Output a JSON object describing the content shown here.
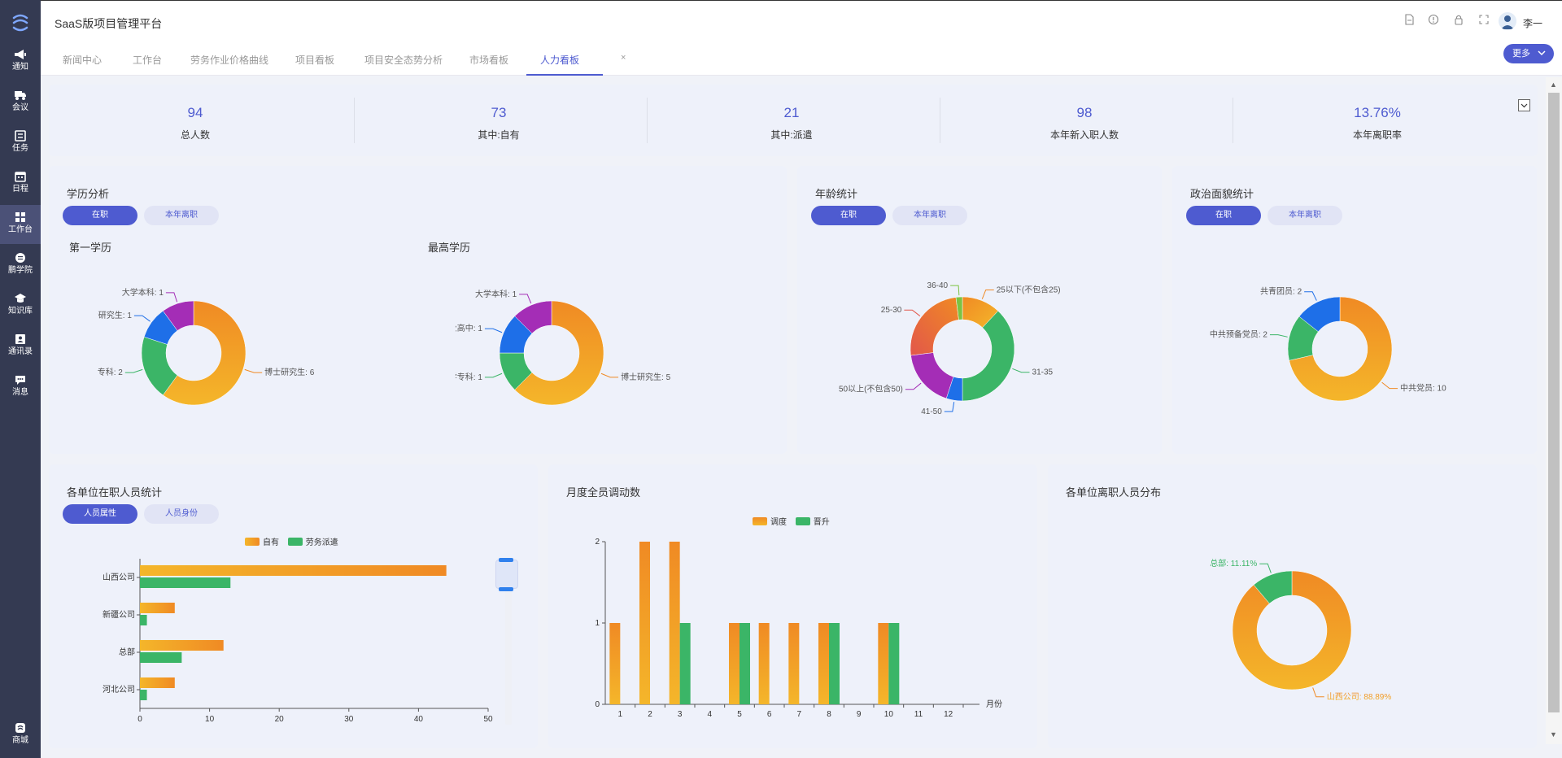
{
  "app": {
    "title": "SaaS版项目管理平台",
    "user_name": "李一",
    "more_label": "更多"
  },
  "nav": [
    {
      "label": "通知",
      "icon": "megaphone-icon"
    },
    {
      "label": "会议",
      "icon": "truck-icon"
    },
    {
      "label": "任务",
      "icon": "task-list-icon"
    },
    {
      "label": "日程",
      "icon": "calendar-icon"
    },
    {
      "label": "工作台",
      "icon": "grid-icon"
    },
    {
      "label": "鹏学院",
      "icon": "academy-icon"
    },
    {
      "label": "知识库",
      "icon": "graduation-cap-icon"
    },
    {
      "label": "通讯录",
      "icon": "contacts-icon"
    },
    {
      "label": "消息",
      "icon": "chat-icon"
    }
  ],
  "nav_bottom": {
    "label": "商城",
    "icon": "store-icon"
  },
  "tabs": [
    "新闻中心",
    "工作台",
    "劳务作业价格曲线",
    "项目看板",
    "项目安全态势分析",
    "市场看板",
    "人力看板"
  ],
  "tab_close": "×",
  "stats": [
    {
      "value": "94",
      "label": "总人数"
    },
    {
      "value": "73",
      "label": "其中:自有"
    },
    {
      "value": "21",
      "label": "其中:派遣"
    },
    {
      "value": "98",
      "label": "本年新入职人数"
    },
    {
      "value": "13.76%",
      "label": "本年离职率"
    }
  ],
  "toggle": {
    "on": "在职",
    "off": "本年离职"
  },
  "education": {
    "title": "学历分析",
    "first_title": "第一学历",
    "highest_title": "最高学历"
  },
  "age": {
    "title": "年龄统计"
  },
  "political": {
    "title": "政治面貌统计"
  },
  "units": {
    "title": "各单位在职人员统计",
    "toggle_on": "人员属性",
    "toggle_off": "人员身份"
  },
  "monthly": {
    "title": "月度全员调动数"
  },
  "resign": {
    "title": "各单位离职人员分布"
  },
  "colors": {
    "orange": "#f08a24",
    "yellow": "#f4b62a",
    "green": "#3bb567",
    "blue": "#1e6fe8",
    "purple": "#a42db6",
    "red": "#e2574a",
    "accent": "#4e5bd0"
  },
  "chart_data": [
    {
      "type": "pie",
      "title": "第一学历",
      "donut": true,
      "slices": [
        {
          "name": "博士研究生",
          "value": 6
        },
        {
          "name": "大学专科",
          "value": 2
        },
        {
          "name": "硕士研究生",
          "value": 1
        },
        {
          "name": "大学本科",
          "value": 1
        }
      ]
    },
    {
      "type": "pie",
      "title": "最高学历",
      "donut": true,
      "slices": [
        {
          "name": "博士研究生",
          "value": 5
        },
        {
          "name": "大学专科",
          "value": 1
        },
        {
          "name": "职业高中",
          "value": 1
        },
        {
          "name": "大学本科",
          "value": 1
        }
      ]
    },
    {
      "type": "pie",
      "title": "年龄统计",
      "donut": true,
      "values_shown": false,
      "slices": [
        {
          "name": "25以下(不包含25)",
          "value": 12
        },
        {
          "name": "31-35",
          "value": 38
        },
        {
          "name": "41-50",
          "value": 5
        },
        {
          "name": "50以上(不包含50)",
          "value": 18
        },
        {
          "name": "25-30",
          "value": 25
        },
        {
          "name": "36-40",
          "value": 2
        }
      ]
    },
    {
      "type": "pie",
      "title": "政治面貌统计",
      "donut": true,
      "slices": [
        {
          "name": "中共党员",
          "value": 10
        },
        {
          "name": "中共预备党员",
          "value": 2
        },
        {
          "name": "共青团员",
          "value": 2
        }
      ]
    },
    {
      "type": "bar",
      "orientation": "horizontal",
      "title": "各单位在职人员统计",
      "categories": [
        "山西公司",
        "新疆公司",
        "总部",
        "河北公司"
      ],
      "series": [
        {
          "name": "自有",
          "values": [
            44,
            5,
            12,
            5
          ]
        },
        {
          "name": "劳务派遣",
          "values": [
            13,
            1,
            6,
            1
          ]
        }
      ],
      "xlim": [
        0,
        50
      ],
      "xticks": [
        "0",
        "10",
        "20",
        "30",
        "40",
        "50"
      ],
      "legend": "top-center"
    },
    {
      "type": "bar",
      "title": "月度全员调动数",
      "categories": [
        "1",
        "2",
        "3",
        "4",
        "5",
        "6",
        "7",
        "8",
        "9",
        "10",
        "11",
        "12"
      ],
      "xlabel": "月份",
      "series": [
        {
          "name": "调度",
          "values": [
            1,
            2,
            2,
            0,
            1,
            1,
            1,
            1,
            0,
            1,
            0,
            0
          ]
        },
        {
          "name": "晋升",
          "values": [
            0,
            0,
            1,
            0,
            1,
            0,
            0,
            1,
            0,
            1,
            0,
            0
          ]
        }
      ],
      "ylim": [
        0,
        2
      ],
      "yticks": [
        "0",
        "1",
        "2"
      ],
      "legend": "top-center"
    },
    {
      "type": "pie",
      "title": "各单位离职人员分布",
      "donut": true,
      "slices": [
        {
          "name": "山西公司",
          "label": "山西公司: 88.89%",
          "value": 88.89
        },
        {
          "name": "总部",
          "label": "总部: 11.11%",
          "value": 11.11
        }
      ]
    }
  ]
}
